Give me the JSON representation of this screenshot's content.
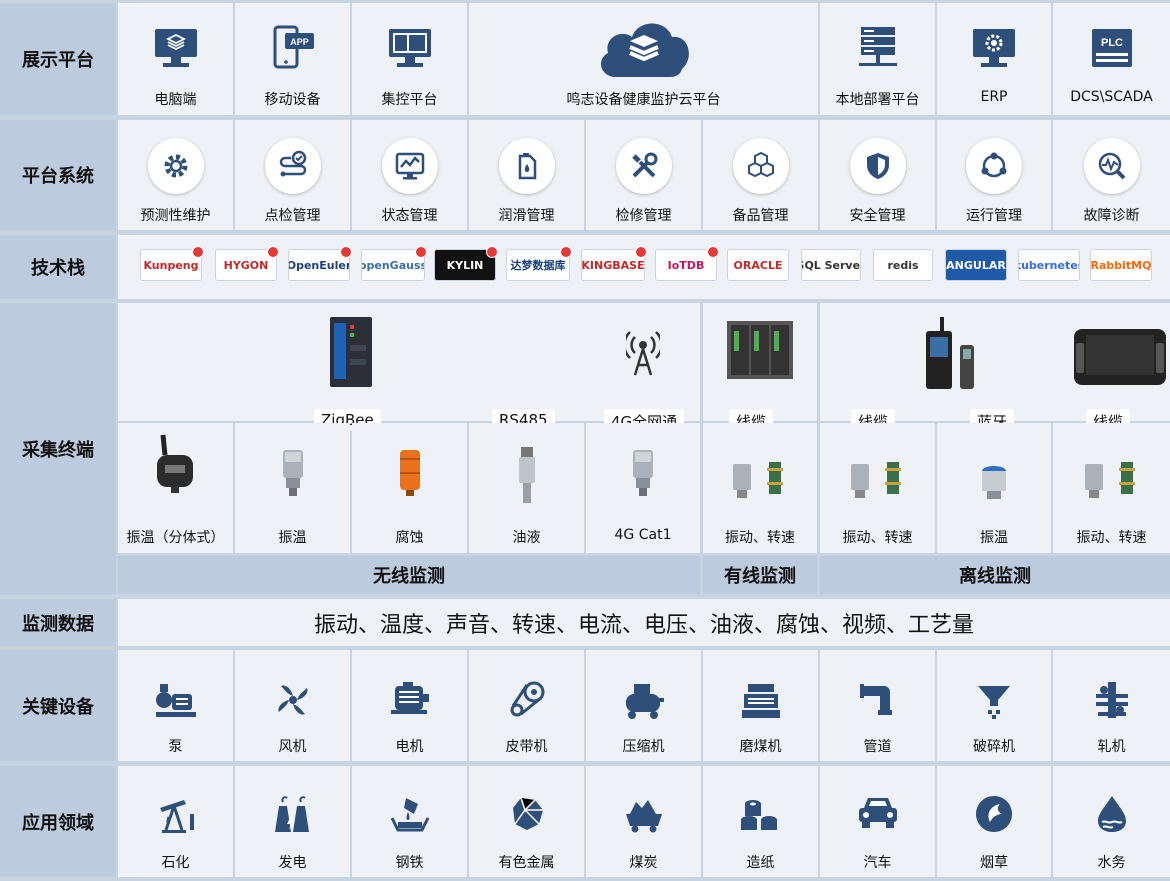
{
  "rows": {
    "display": {
      "header": "展示平台",
      "items": [
        {
          "label": "电脑端",
          "icon": "monitor-icon"
        },
        {
          "label": "移动设备",
          "icon": "mobile-app-icon"
        },
        {
          "label": "集控平台",
          "icon": "control-screen-icon"
        },
        {
          "label": "鸣志设备健康监护云平台",
          "icon": "cloud-database-icon"
        },
        {
          "label": "本地部署平台",
          "icon": "server-icon"
        },
        {
          "label": "ERP",
          "icon": "gear-monitor-icon"
        },
        {
          "label": "DCS\\SCADA",
          "icon": "plc-icon",
          "icon_text": "PLC"
        }
      ]
    },
    "platform": {
      "header": "平台系统",
      "items": [
        {
          "label": "预测性维护",
          "icon": "gear-icon"
        },
        {
          "label": "点检管理",
          "icon": "route-check-icon"
        },
        {
          "label": "状态管理",
          "icon": "status-chart-icon"
        },
        {
          "label": "润滑管理",
          "icon": "oil-can-icon"
        },
        {
          "label": "检修管理",
          "icon": "tools-icon"
        },
        {
          "label": "备品管理",
          "icon": "cubes-icon"
        },
        {
          "label": "安全管理",
          "icon": "shield-icon"
        },
        {
          "label": "运行管理",
          "icon": "cycle-icon"
        },
        {
          "label": "故障诊断",
          "icon": "diagnosis-icon"
        }
      ]
    },
    "techstack": {
      "header": "技术栈",
      "logos": [
        {
          "text": "Kunpeng",
          "color": "#c62828"
        },
        {
          "text": "HYGON",
          "color": "#c62828"
        },
        {
          "text": "OpenEuler",
          "color": "#1a3f7a"
        },
        {
          "text": "openGauss",
          "color": "#3a6ea5"
        },
        {
          "text": "KYLIN",
          "color": "#ffffff"
        },
        {
          "text": "达梦数据库",
          "color": "#1a3f7a"
        },
        {
          "text": "KINGBASE",
          "color": "#c62828"
        },
        {
          "text": "IoTDB",
          "color": "#c2185b"
        },
        {
          "text": "ORACLE",
          "color": "#c62828"
        },
        {
          "text": "SQL Server",
          "color": "#333333"
        },
        {
          "text": "redis",
          "color": "#333333"
        },
        {
          "text": "ANGULAR",
          "color": "#ffffff"
        },
        {
          "text": "kubernetes",
          "color": "#326ce5"
        },
        {
          "text": "RabbitMQ",
          "color": "#ff6600"
        }
      ]
    },
    "collection": {
      "header": "采集终端",
      "gateway_tags": [
        "ZigBee",
        "RS485",
        "4G全网通"
      ],
      "wired_tag": "线缆",
      "offline_tags": [
        "线缆",
        "蓝牙",
        "线缆"
      ],
      "sensors": [
        "振温（分体式）",
        "振温",
        "腐蚀",
        "油液",
        "4G Cat1",
        "振动、转速",
        "振动、转速",
        "振温",
        "振动、转速"
      ],
      "sections": [
        "无线监测",
        "有线监测",
        "离线监测"
      ]
    },
    "data": {
      "header": "监测数据",
      "text": "振动、温度、声音、转速、电流、电压、油液、腐蚀、视频、工艺量"
    },
    "equipment": {
      "header": "关键设备",
      "items": [
        {
          "label": "泵",
          "icon": "pump-icon"
        },
        {
          "label": "风机",
          "icon": "fan-icon"
        },
        {
          "label": "电机",
          "icon": "motor-icon"
        },
        {
          "label": "皮带机",
          "icon": "belt-icon"
        },
        {
          "label": "压缩机",
          "icon": "compressor-icon"
        },
        {
          "label": "磨煤机",
          "icon": "mill-icon"
        },
        {
          "label": "管道",
          "icon": "pipe-icon"
        },
        {
          "label": "破碎机",
          "icon": "crusher-icon"
        },
        {
          "label": "轧机",
          "icon": "rolling-mill-icon"
        }
      ]
    },
    "application": {
      "header": "应用领域",
      "items": [
        {
          "label": "石化",
          "icon": "oil-pump-icon"
        },
        {
          "label": "发电",
          "icon": "power-plant-icon"
        },
        {
          "label": "钢铁",
          "icon": "steel-icon"
        },
        {
          "label": "有色金属",
          "icon": "ore-icon"
        },
        {
          "label": "煤炭",
          "icon": "coal-cart-icon"
        },
        {
          "label": "造纸",
          "icon": "paper-roll-icon"
        },
        {
          "label": "汽车",
          "icon": "car-icon"
        },
        {
          "label": "烟草",
          "icon": "tobacco-icon"
        },
        {
          "label": "水务",
          "icon": "water-drop-icon"
        }
      ]
    }
  },
  "colors": {
    "icon": "#2e4f7a",
    "header_bg": "#bccbde",
    "cell_bg": "#eef2f7",
    "grid": "#c9d4e2",
    "badge": "#e53935"
  }
}
